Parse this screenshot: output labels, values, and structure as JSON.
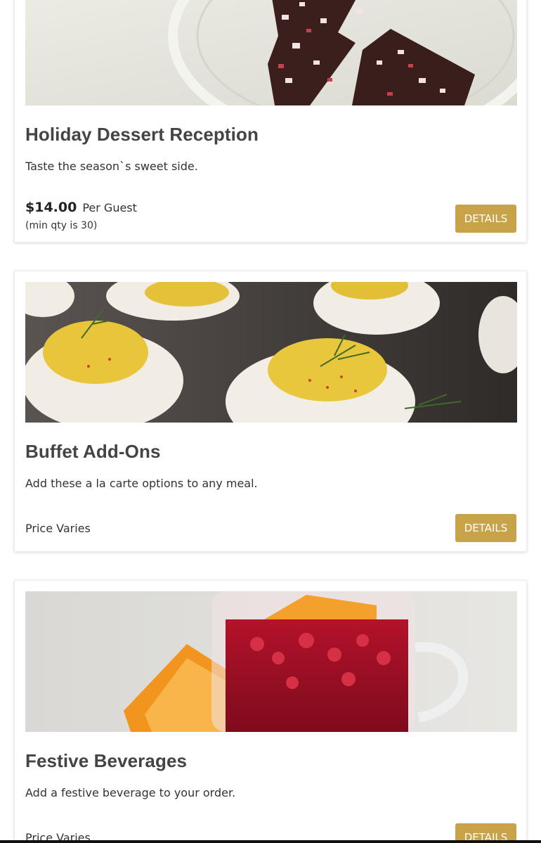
{
  "cards": [
    {
      "title": "Holiday Dessert Reception",
      "description": "Taste the season`s sweet side.",
      "price": "$14.00",
      "price_unit": "Per Guest",
      "min_qty": "(min qty is 30)",
      "button_label": "DETAILS",
      "image_subject": "peppermint-bark-on-plate"
    },
    {
      "title": "Buffet Add-Ons",
      "description": "Add these a la carte options to any meal.",
      "price_text": "Price Varies",
      "button_label": "DETAILS",
      "image_subject": "deviled-eggs"
    },
    {
      "title": "Festive Beverages",
      "description": "Add a festive beverage to your order.",
      "price_text": "Price Varies",
      "button_label": "DETAILS",
      "image_subject": "cranberry-punch-mug"
    }
  ],
  "colors": {
    "button": "#c9a349",
    "title": "#444444",
    "text": "#333333"
  }
}
